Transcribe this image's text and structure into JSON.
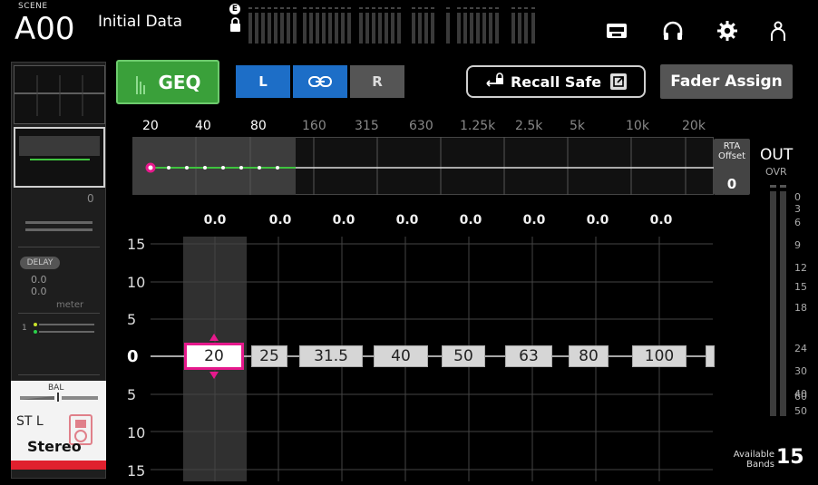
{
  "header": {
    "scene_tag": "SCENE",
    "scene_number": "A00",
    "scene_name": "Initial Data",
    "lock_badge": "E"
  },
  "toolbar_icons": [
    "cassette-icon",
    "headphones-icon",
    "gear-icon",
    "user-icon"
  ],
  "strip": {
    "level": "0",
    "delay_badge": "DELAY",
    "delay_value_1": "0.0",
    "delay_value_2": "0.0",
    "delay_unit": "meter",
    "bal_label": "BAL",
    "channel_name": "ST L",
    "channel_type": "Stereo"
  },
  "buttons": {
    "geq": "GEQ",
    "left": "L",
    "right": "R",
    "recall_safe": "Recall Safe",
    "fader_assign": "Fader Assign"
  },
  "overview": {
    "freq_labels": [
      "20",
      "40",
      "80",
      "160",
      "315",
      "630",
      "1.25k",
      "2.5k",
      "5k",
      "10k",
      "20k"
    ],
    "rta_offset_label": "RTA Offset",
    "rta_offset_value": "0"
  },
  "out": {
    "label": "OUT",
    "ovr": "OVR",
    "scale": [
      "0",
      "3",
      "6",
      "9",
      "12",
      "15",
      "18",
      "24",
      "30",
      "40",
      "50",
      "60"
    ]
  },
  "geq": {
    "gain_values": [
      "0.0",
      "0.0",
      "0.0",
      "0.0",
      "0.0",
      "0.0",
      "0.0",
      "0.0"
    ],
    "db_labels": [
      "15",
      "10",
      "5",
      "0",
      "5",
      "10",
      "15"
    ],
    "bands": [
      "20",
      "25",
      "31.5",
      "40",
      "50",
      "63",
      "80",
      "100"
    ],
    "selected_band": "20",
    "available_label_1": "Available",
    "available_label_2": "Bands",
    "available_count": "15"
  },
  "colors": {
    "geq_green": "#3aa03a",
    "link_blue": "#1d6ec7",
    "selection_pink": "#e6198c",
    "stereo_red": "#e0202e"
  }
}
